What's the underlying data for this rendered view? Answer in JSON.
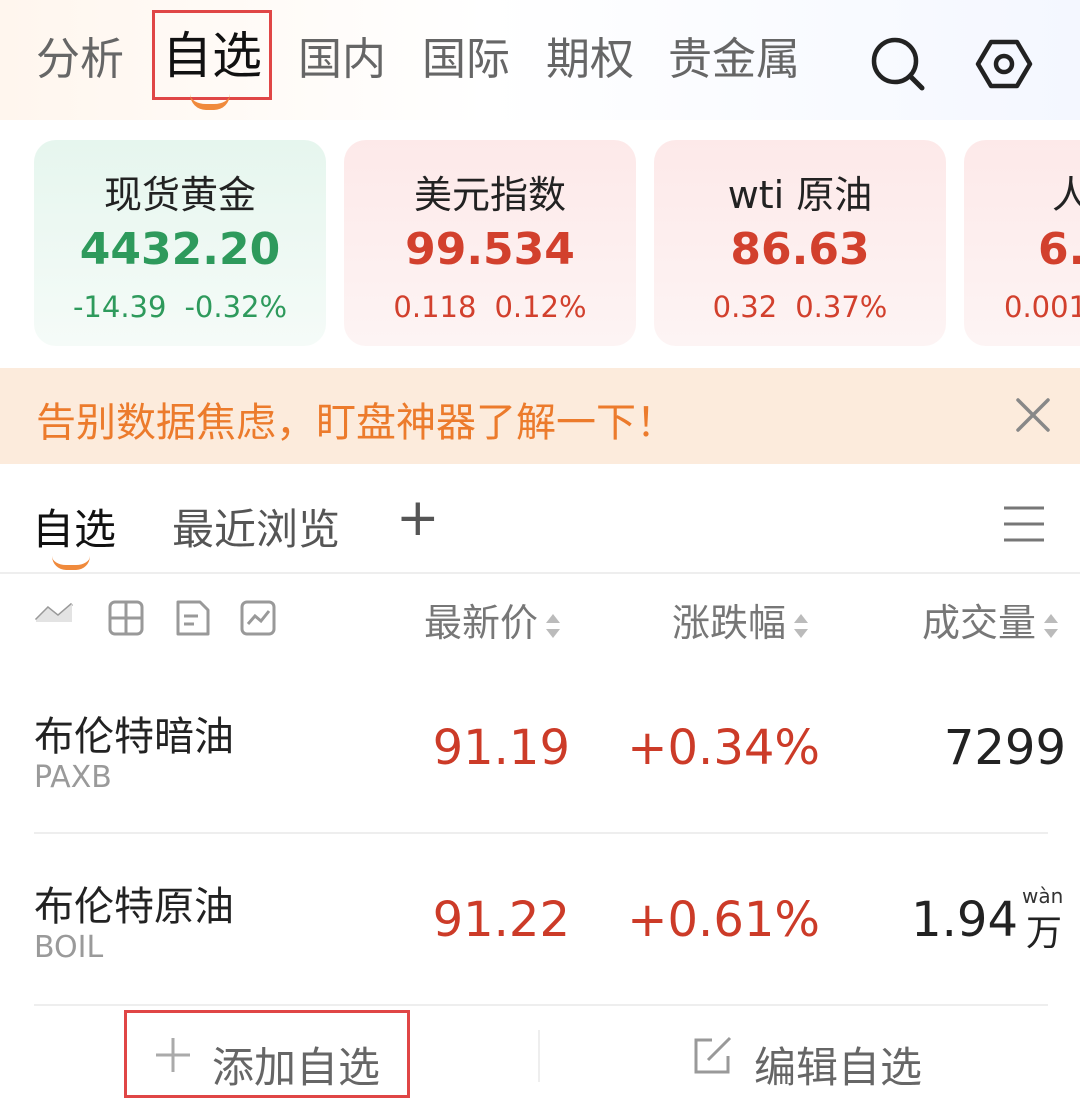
{
  "top_nav": {
    "tabs": [
      {
        "label": "分析"
      },
      {
        "label": "自选"
      },
      {
        "label": "国内"
      },
      {
        "label": "国际"
      },
      {
        "label": "期权"
      },
      {
        "label": "贵金属"
      }
    ],
    "active_tab": "自选",
    "icons": [
      "search-icon",
      "settings-hexagon-icon"
    ]
  },
  "quote_cards": [
    {
      "name": "现货黄金",
      "price": "4432.20",
      "change": "-14.39",
      "change_pct": "-0.32%",
      "trend": "down"
    },
    {
      "name": "美元指数",
      "price": "99.534",
      "change": "0.118",
      "change_pct": "0.12%",
      "trend": "up"
    },
    {
      "name": "wti 原油",
      "price": "86.63",
      "change": "0.32",
      "change_pct": "0.37%",
      "trend": "up"
    },
    {
      "name": "人",
      "price": "6.",
      "change": "0.001",
      "change_pct": "",
      "trend": "up"
    }
  ],
  "banner": {
    "text": "告别数据焦虑，盯盘神器了解一下！"
  },
  "sub_tabs": {
    "items": [
      {
        "label": "自选"
      },
      {
        "label": "最近浏览"
      }
    ],
    "add_symbol": "+",
    "active": "自选"
  },
  "list_header": {
    "view_icons": [
      "line-view-icon",
      "grid-view-icon",
      "card-view-icon",
      "chart-view-icon"
    ],
    "columns": [
      {
        "label": "最新价"
      },
      {
        "label": "涨跌幅"
      },
      {
        "label": "成交量"
      }
    ]
  },
  "rows": [
    {
      "name": "布伦特暗油",
      "code": "PAXB",
      "price": "91.19",
      "change_pct": "+0.34%",
      "volume": "7299",
      "volume_unit": "",
      "volume_unit_pinyin": ""
    },
    {
      "name": "布伦特原油",
      "code": "BOIL",
      "price": "91.22",
      "change_pct": "+0.61%",
      "volume": "1.94",
      "volume_unit": "万",
      "volume_unit_pinyin": "wàn"
    }
  ],
  "bottom_actions": {
    "add_label": "添加自选",
    "edit_label": "编辑自选"
  },
  "colors": {
    "up": "#cc3b28",
    "down": "#2e9a5c",
    "accent": "#f08a3c",
    "highlight_box": "#e04646",
    "banner_text": "#ec7b2c"
  }
}
